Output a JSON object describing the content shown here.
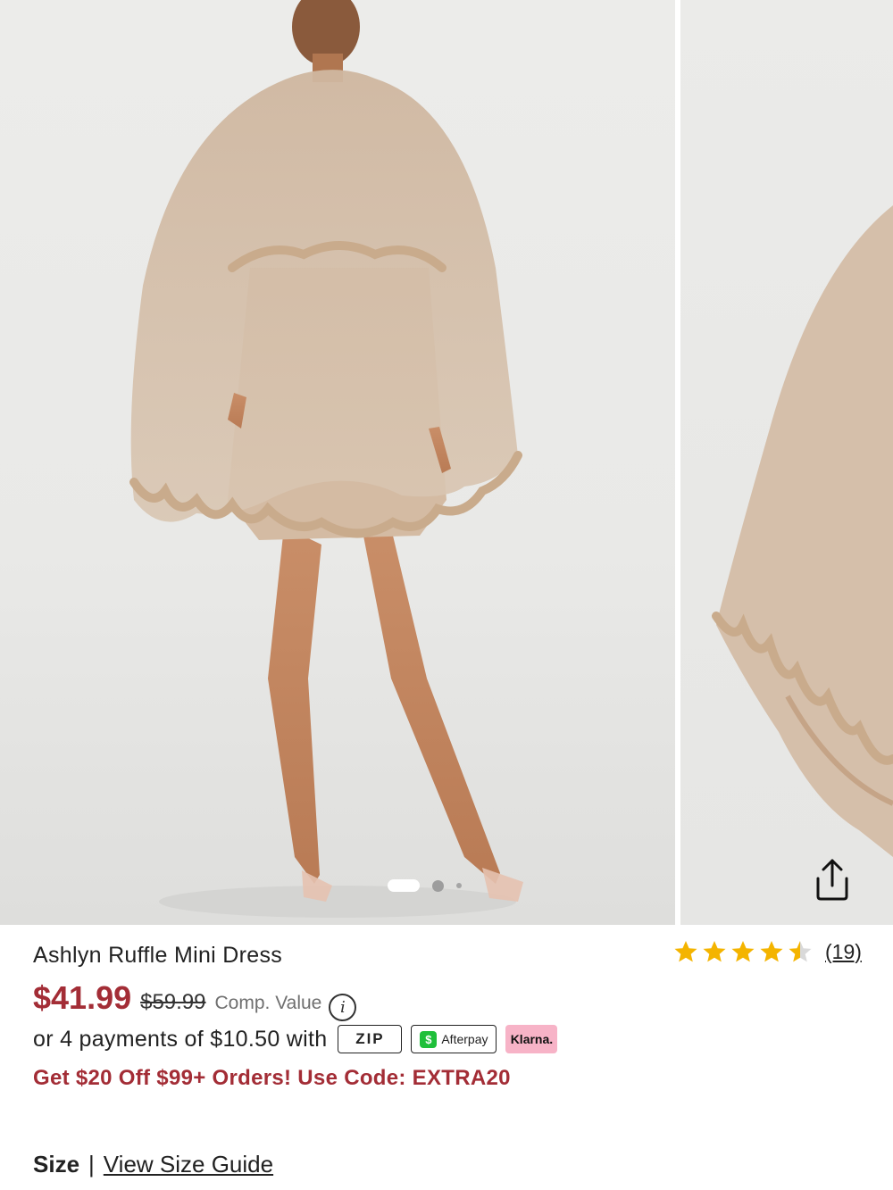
{
  "product": {
    "title": "Ashlyn Ruffle Mini Dress",
    "rating": 4.5,
    "rating_max": 5,
    "review_count": "(19)",
    "price": "$41.99",
    "old_price": "$59.99",
    "comp_label": "Comp. Value",
    "payments_text": "or 4 payments of $10.50 with",
    "promo": "Get $20 Off $99+ Orders! Use Code: EXTRA20"
  },
  "payment_badges": {
    "zip": "ZIP",
    "afterpay": "Afterpay",
    "klarna": "Klarna."
  },
  "gallery": {
    "slides_total": 3,
    "active_index": 1
  },
  "size": {
    "label": "Size",
    "separator": "|",
    "guide_link": "View Size Guide"
  },
  "colors": {
    "price_red": "#a32d36",
    "star_gold": "#f4b400",
    "klarna_pink": "#f7b3c7",
    "cash_green": "#1fbf3a"
  },
  "icons": {
    "share": "share-icon",
    "info": "info-icon",
    "star": "star-icon"
  }
}
